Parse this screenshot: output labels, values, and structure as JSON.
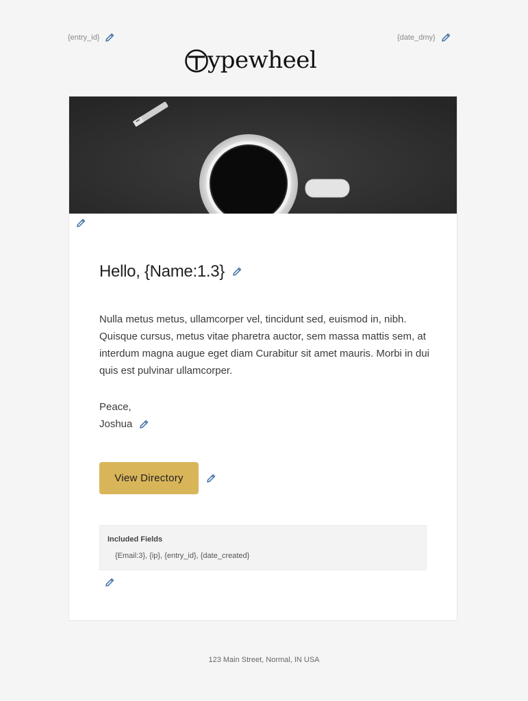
{
  "header": {
    "entry_placeholder": "{entry_id}",
    "date_placeholder": "{date_dmy}",
    "logo_text": "ypewheel",
    "logo_initial": "T"
  },
  "content": {
    "greeting": "Hello, {Name:1.3}",
    "body": "Nulla metus metus, ullamcorper vel, tincidunt sed, euismod in, nibh. Quisque cursus, metus vitae pharetra auctor, sem massa mattis sem, at interdum magna augue eget diam Curabitur sit amet mauris. Morbi in dui quis est pulvinar ullamcorper.",
    "signoff": "Peace,",
    "signer": "Joshua",
    "button_label": "View Directory"
  },
  "included_fields": {
    "title": "Included Fields",
    "list": "{Email:3}, {ip}, {entry_id}, {date_created}"
  },
  "footer": {
    "address": "123 Main Street, Normal, IN USA"
  },
  "colors": {
    "background": "#f5f5f5",
    "card": "#ffffff",
    "button": "#d9b55a",
    "edit_icon": "#4a78a8"
  },
  "icons": {
    "edit": "pencil-icon"
  }
}
